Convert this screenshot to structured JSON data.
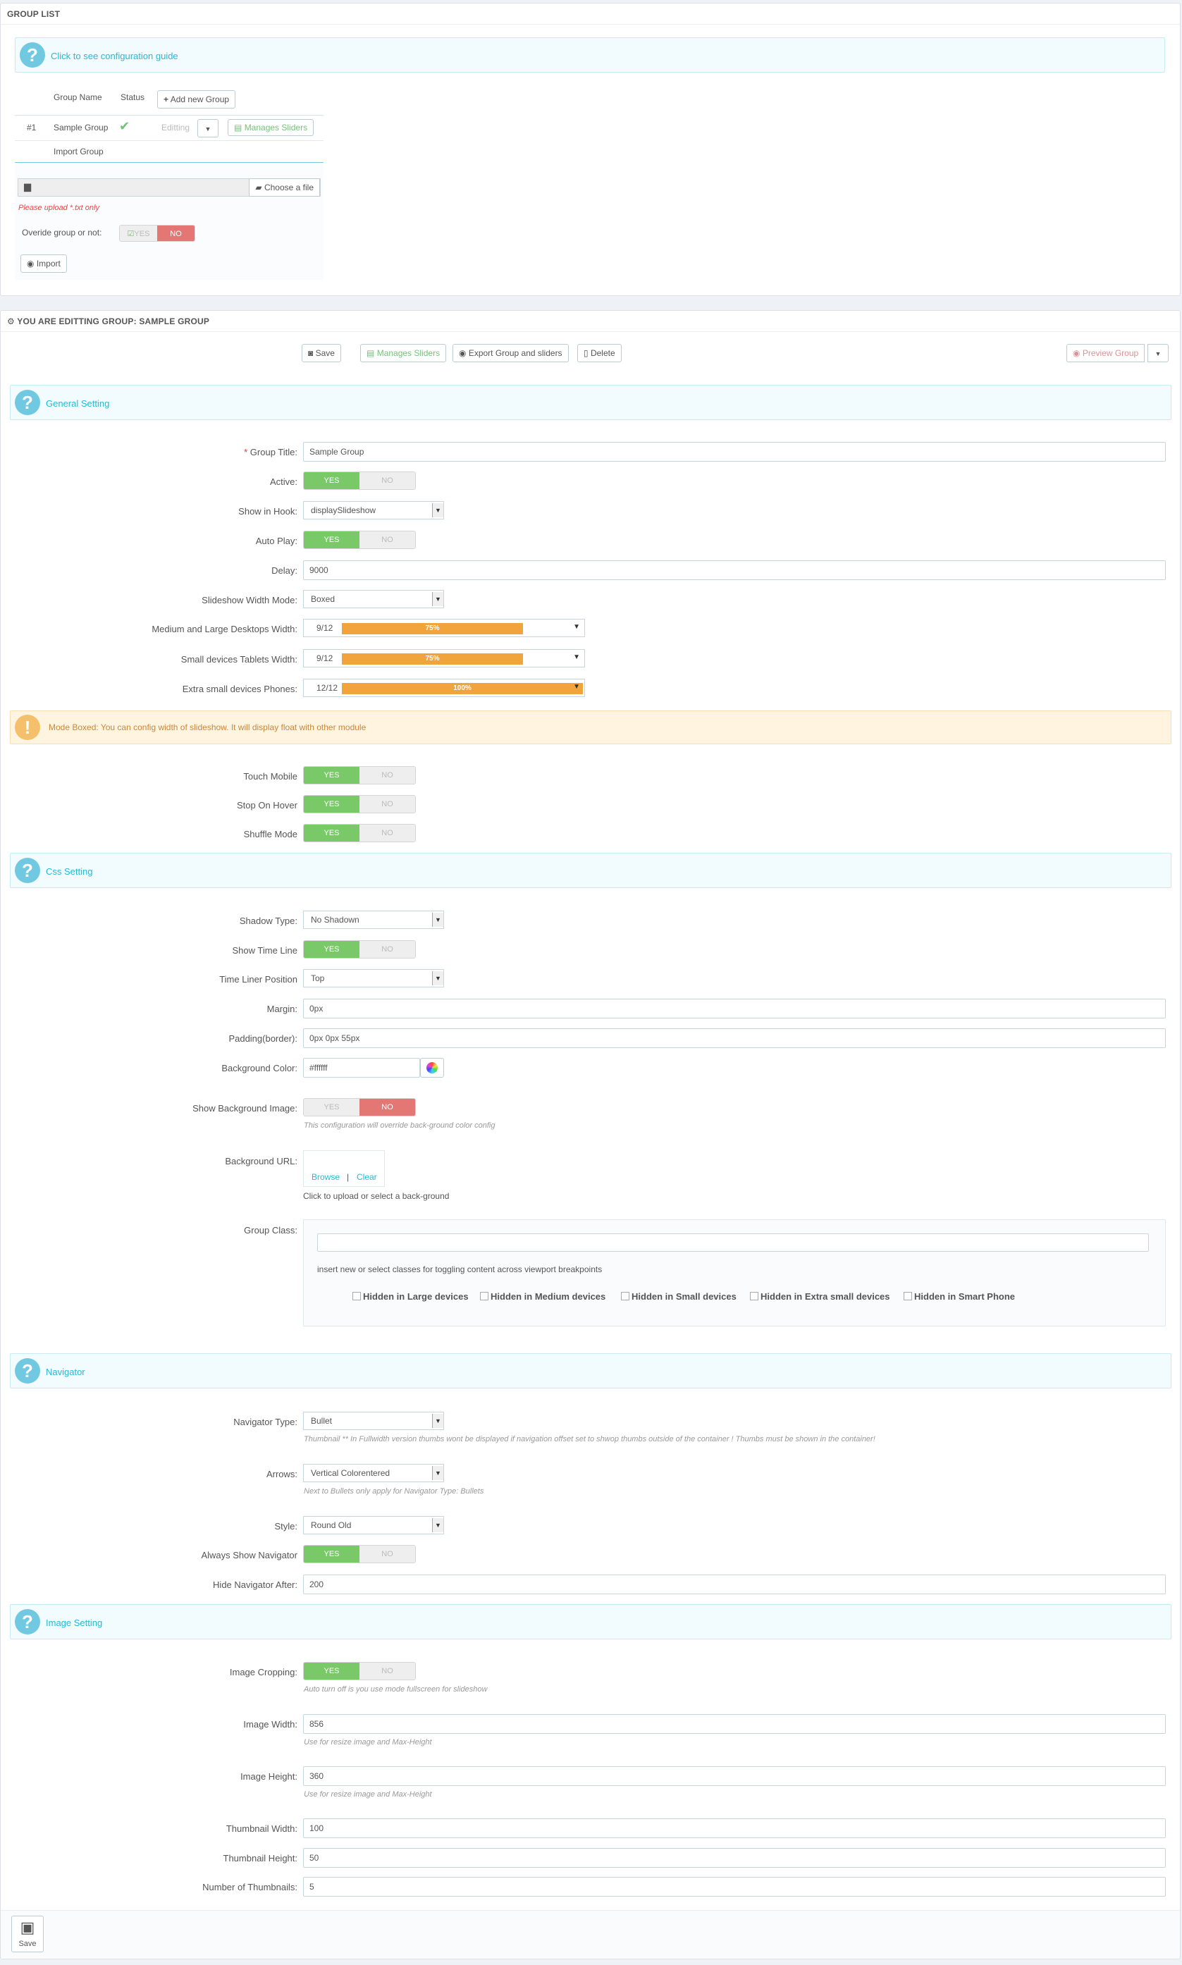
{
  "group_list": {
    "title": "GROUP LIST",
    "guide_link": "Click to see configuration guide",
    "headers": {
      "name": "Group Name",
      "status": "Status",
      "add_btn": "Add new Group"
    },
    "row": {
      "id": "#1",
      "name": "Sample Group",
      "editing": "Editting",
      "manage": "Manages Sliders"
    },
    "import_title": "Import Group",
    "choose_file": "Choose a file",
    "upload_hint": "Please upload *.txt only",
    "override_label": "Overide group or not:",
    "yes": "YES",
    "no": "NO",
    "import_btn": "Import"
  },
  "editing": {
    "title": "YOU ARE EDITTING GROUP: SAMPLE GROUP",
    "toolbar": {
      "save": "Save",
      "manage": "Manages Sliders",
      "export": "Export Group and sliders",
      "delete": "Delete",
      "preview": "Preview Group"
    }
  },
  "general": {
    "title": "General Setting",
    "group_title_label": "Group Title:",
    "group_title_value": "Sample Group",
    "active_label": "Active:",
    "hook_label": "Show in Hook:",
    "hook_value": "displaySlideshow",
    "autoplay_label": "Auto Play:",
    "delay_label": "Delay:",
    "delay_value": "9000",
    "width_mode_label": "Slideshow Width Mode:",
    "width_mode_value": "Boxed",
    "md_lg_label": "Medium and Large Desktops Width:",
    "md_lg_frac": "9/12",
    "md_lg_pct": "75%",
    "md_lg_fill": 0.75,
    "sm_label": "Small devices Tablets Width:",
    "sm_frac": "9/12",
    "sm_pct": "75%",
    "sm_fill": 0.75,
    "xs_label": "Extra small devices Phones:",
    "xs_frac": "12/12",
    "xs_pct": "100%",
    "xs_fill": 1.0,
    "warning": "Mode Boxed: You can config width of slideshow. It will display float with other module",
    "touch_label": "Touch Mobile",
    "hover_label": "Stop On Hover",
    "shuffle_label": "Shuffle Mode"
  },
  "css": {
    "title": "Css Setting",
    "shadow_label": "Shadow Type:",
    "shadow_value": "No Shadown",
    "timeline_label": "Show Time Line",
    "timeline_pos_label": "Time Liner Position",
    "timeline_pos_value": "Top",
    "margin_label": "Margin:",
    "margin_value": "0px",
    "padding_label": "Padding(border):",
    "padding_value": "0px 0px 55px",
    "bgcolor_label": "Background Color:",
    "bgcolor_value": "#ffffff",
    "show_bg_label": "Show Background Image:",
    "show_bg_hint": "This configuration will override back-ground color config",
    "bg_url_label": "Background URL:",
    "browse": "Browse",
    "sep": "|",
    "clear": "Clear",
    "bg_url_hint": "Click to upload or select a back-ground",
    "group_class_label": "Group Class:",
    "group_class_hint": "insert new or select classes for toggling content across viewport breakpoints",
    "hidden_options": [
      "Hidden in Large devices",
      "Hidden in Medium devices",
      "Hidden in Small devices",
      "Hidden in Extra small devices",
      "Hidden in Smart Phone"
    ]
  },
  "navigator": {
    "title": "Navigator",
    "type_label": "Navigator Type:",
    "type_value": "Bullet",
    "type_hint": "Thumbnail ** In Fullwidth version thumbs wont be displayed if navigation offset set to shwop thumbs outside of the container ! Thumbs must be shown in the container!",
    "arrows_label": "Arrows:",
    "arrows_value": "Vertical Colorentered",
    "arrows_hint": "Next to Bullets only apply for Navigator Type: Bullets",
    "style_label": "Style:",
    "style_value": "Round Old",
    "always_label": "Always Show Navigator",
    "hide_after_label": "Hide Navigator After:",
    "hide_after_value": "200"
  },
  "image": {
    "title": "Image Setting",
    "crop_label": "Image Cropping:",
    "crop_hint": "Auto turn off is you use mode fullscreen for slideshow",
    "width_label": "Image Width:",
    "width_value": "856",
    "width_hint": "Use for resize image and Max-Height",
    "height_label": "Image Height:",
    "height_value": "360",
    "height_hint": "Use for resize image and Max-Height",
    "thumb_w_label": "Thumbnail Width:",
    "thumb_w_value": "100",
    "thumb_h_label": "Thumbnail Height:",
    "thumb_h_value": "50",
    "num_thumbs_label": "Number of Thumbnails:",
    "num_thumbs_value": "5"
  },
  "footer": {
    "save": "Save"
  },
  "colors": {
    "green": "#79c969",
    "red": "#e47774",
    "accent": "#25b9d7",
    "orange": "#f0a43b"
  }
}
